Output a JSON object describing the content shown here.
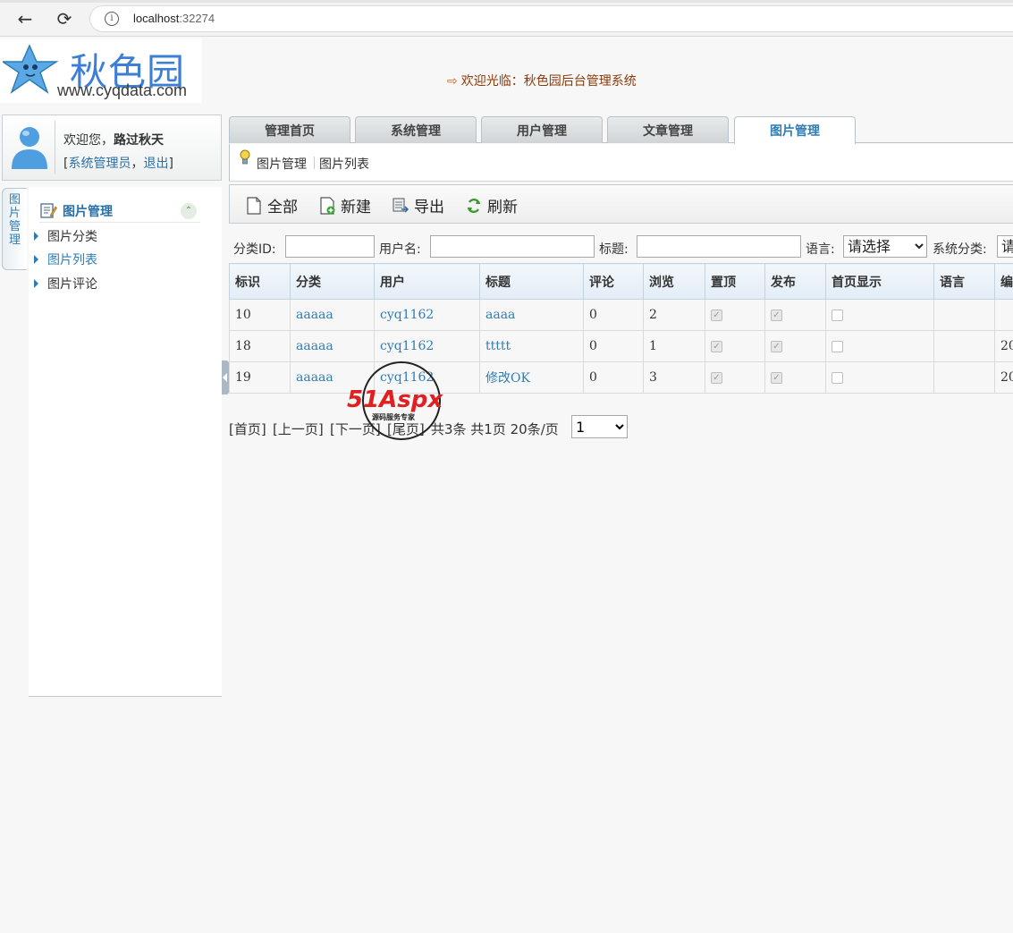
{
  "browser": {
    "url_host": "localhost",
    "url_port": ":32274"
  },
  "header": {
    "logo_brand": "秋色园",
    "logo_domain": "www.cyqdata.com",
    "welcome": "欢迎光临：秋色园后台管理系统"
  },
  "user": {
    "greeting_prefix": "欢迎您，",
    "name": "路过秋天",
    "role_link": "系统管理员",
    "logout_link": "退出"
  },
  "side_tab": [
    "图",
    "片",
    "管",
    "理"
  ],
  "sidebar": {
    "heading": "图片管理",
    "items": [
      {
        "label": "图片分类",
        "active": false
      },
      {
        "label": "图片列表",
        "active": true
      },
      {
        "label": "图片评论",
        "active": false
      }
    ]
  },
  "tabs": [
    {
      "label": "管理首页",
      "active": false
    },
    {
      "label": "系统管理",
      "active": false
    },
    {
      "label": "用户管理",
      "active": false
    },
    {
      "label": "文章管理",
      "active": false
    },
    {
      "label": "图片管理",
      "active": true
    }
  ],
  "breadcrumb": [
    "图片管理",
    "图片列表"
  ],
  "toolbar": {
    "all": "全部",
    "new": "新建",
    "export": "导出",
    "refresh": "刷新"
  },
  "search": {
    "category_id_label": "分类ID:",
    "username_label": "用户名:",
    "title_label": "标题:",
    "language_label": "语言:",
    "language_value": "请选择",
    "sys_category_label": "系统分类:",
    "sys_category_value": "请"
  },
  "table": {
    "columns": [
      "标识",
      "分类",
      "用户",
      "标题",
      "评论",
      "浏览",
      "置顶",
      "发布",
      "首页显示",
      "语言",
      "编"
    ],
    "rows": [
      {
        "id": "10",
        "category": "aaaaa",
        "user": "cyq1162",
        "title": "aaaa",
        "comments": "0",
        "views": "2",
        "top": true,
        "publish": true,
        "home": false,
        "lang": "",
        "edit": ""
      },
      {
        "id": "18",
        "category": "aaaaa",
        "user": "cyq1162",
        "title": "ttttt",
        "comments": "0",
        "views": "1",
        "top": true,
        "publish": true,
        "home": false,
        "lang": "",
        "edit": "20"
      },
      {
        "id": "19",
        "category": "aaaaa",
        "user": "cyq1162",
        "title": "修改OK",
        "comments": "0",
        "views": "3",
        "top": true,
        "publish": true,
        "home": false,
        "lang": "",
        "edit": "20"
      }
    ]
  },
  "pager": {
    "first": "[首页]",
    "prev": "[上一页]",
    "next": "[下一页]",
    "last": "[尾页]",
    "summary": "共3条 共1页 20条/页",
    "page_value": "1"
  },
  "watermark": {
    "brand": "51Aspx",
    "tagline": "源码服务专家"
  },
  "colors": {
    "link": "#2f7db5",
    "welcome": "#8a3a0a",
    "brand": "#3d7fd6"
  }
}
